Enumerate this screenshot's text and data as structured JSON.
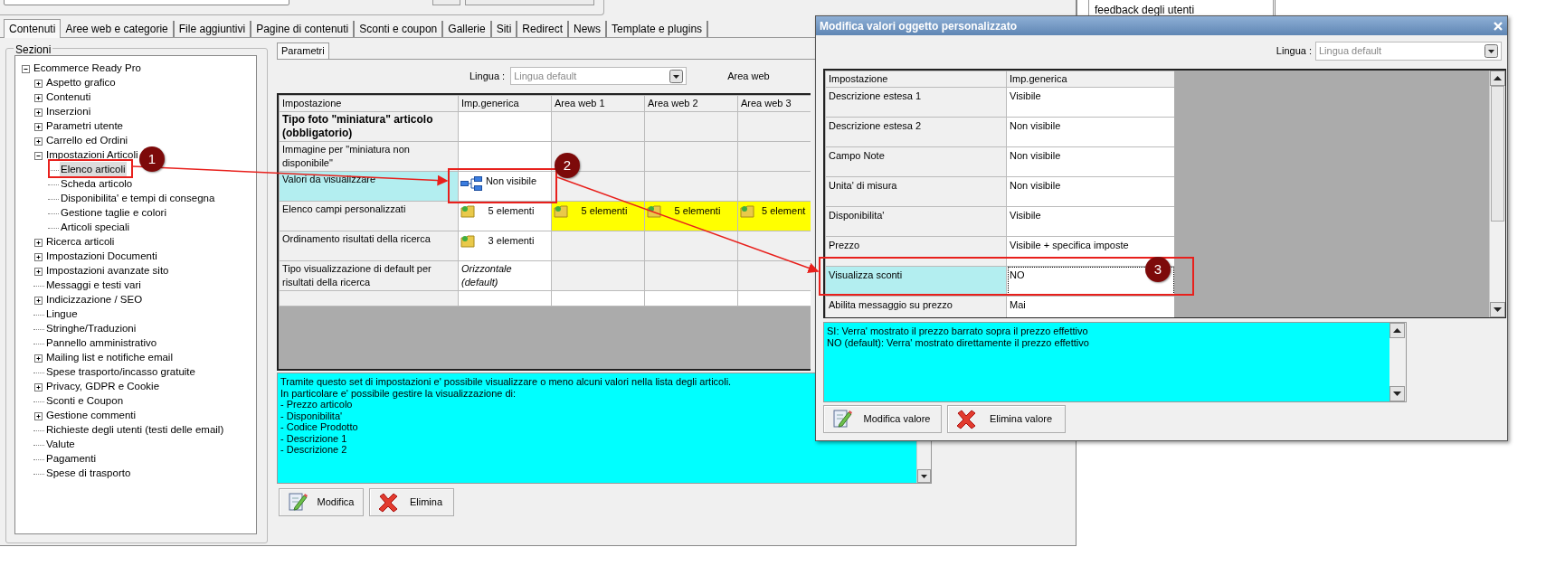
{
  "background_panel": {
    "text": "feedback degli utenti"
  },
  "tabs": [
    {
      "label": "Contenuti",
      "selected": true
    },
    {
      "label": "Aree web e categorie",
      "selected": false
    },
    {
      "label": "File aggiuntivi",
      "selected": false
    },
    {
      "label": "Pagine di contenuti",
      "selected": false
    },
    {
      "label": "Sconti e coupon",
      "selected": false
    },
    {
      "label": "Gallerie",
      "selected": false
    },
    {
      "label": "Siti",
      "selected": false
    },
    {
      "label": "Redirect",
      "selected": false
    },
    {
      "label": "News",
      "selected": false
    },
    {
      "label": "Template e plugins",
      "selected": false
    }
  ],
  "sections": {
    "title": "Sezioni",
    "tree": [
      {
        "label": "Ecommerce Ready Pro",
        "selected": false,
        "expanded": true,
        "children": [
          {
            "label": "Aspetto grafico",
            "selected": false,
            "expanded": false
          },
          {
            "label": "Contenuti",
            "selected": false,
            "expanded": false
          },
          {
            "label": "Inserzioni",
            "selected": false,
            "expanded": false
          },
          {
            "label": "Parametri utente",
            "selected": false,
            "expanded": false
          },
          {
            "label": "Carrello ed Ordini",
            "selected": false,
            "expanded": false
          },
          {
            "label": "Impostazioni Articoli",
            "selected": false,
            "expanded": true,
            "children": [
              {
                "label": "Elenco articoli",
                "selected": true
              },
              {
                "label": "Scheda articolo",
                "selected": false
              },
              {
                "label": "Disponibilita' e tempi di consegna",
                "selected": false
              },
              {
                "label": "Gestione taglie e colori",
                "selected": false
              },
              {
                "label": "Articoli speciali",
                "selected": false
              }
            ]
          },
          {
            "label": "Ricerca articoli",
            "selected": false,
            "expanded": false
          },
          {
            "label": "Impostazioni Documenti",
            "selected": false,
            "expanded": false
          },
          {
            "label": "Impostazioni avanzate sito",
            "selected": false,
            "expanded": false
          },
          {
            "label": "Messaggi e testi vari",
            "selected": false
          },
          {
            "label": "Indicizzazione / SEO",
            "selected": false,
            "expanded": false
          },
          {
            "label": "Lingue",
            "selected": false
          },
          {
            "label": "Stringhe/Traduzioni",
            "selected": false
          },
          {
            "label": "Pannello amministrativo",
            "selected": false
          },
          {
            "label": "Mailing list e notifiche email",
            "selected": false,
            "expanded": false
          },
          {
            "label": "Spese trasporto/incasso gratuite",
            "selected": false
          },
          {
            "label": "Privacy, GDPR e Cookie",
            "selected": false,
            "expanded": false
          },
          {
            "label": "Sconti e Coupon",
            "selected": false
          },
          {
            "label": "Gestione commenti",
            "selected": false,
            "expanded": false
          },
          {
            "label": "Richieste degli utenti (testi delle email)",
            "selected": false
          },
          {
            "label": "Valute",
            "selected": false
          },
          {
            "label": "Pagamenti",
            "selected": false
          },
          {
            "label": "Spese di trasporto",
            "selected": false
          }
        ]
      }
    ]
  },
  "subtabs": [
    {
      "label": "Parametri",
      "selected": true
    }
  ],
  "language": {
    "label": "Lingua :",
    "value": "Lingua default"
  },
  "area_label": "Area web",
  "grid": {
    "columns": [
      "Impostazione",
      "Imp.generica",
      "Area web 1",
      "Area web 2",
      "Area web 3"
    ],
    "rows": [
      {
        "selected": false,
        "cells": [
          {
            "kind": "setting",
            "text": "Tipo foto \"miniatura\" articolo (obbligatorio)",
            "bold": true
          },
          {
            "kind": "empty"
          },
          {
            "kind": "empty"
          },
          {
            "kind": "empty"
          },
          {
            "kind": "empty"
          }
        ]
      },
      {
        "selected": false,
        "cells": [
          {
            "kind": "setting",
            "text": "Immagine per \"miniatura non disponibile\"",
            "bold": false
          },
          {
            "kind": "empty"
          },
          {
            "kind": "empty"
          },
          {
            "kind": "empty"
          },
          {
            "kind": "empty"
          }
        ]
      },
      {
        "selected": true,
        "cells": [
          {
            "kind": "setting",
            "text": "Valori da visualizzare",
            "bold": false
          },
          {
            "kind": "tree",
            "text": "Non visibile"
          },
          {
            "kind": "empty"
          },
          {
            "kind": "empty"
          },
          {
            "kind": "empty"
          }
        ]
      },
      {
        "selected": false,
        "cells": [
          {
            "kind": "setting",
            "text": "Elenco campi personalizzati",
            "bold": false
          },
          {
            "kind": "folder",
            "text": "5 elementi",
            "highlighted": false
          },
          {
            "kind": "folder",
            "text": "5 elementi",
            "highlighted": true
          },
          {
            "kind": "folder",
            "text": "5 elementi",
            "highlighted": true
          },
          {
            "kind": "folder",
            "text": "5 element",
            "highlighted": true
          }
        ]
      },
      {
        "selected": false,
        "cells": [
          {
            "kind": "setting",
            "text": "Ordinamento risultati della ricerca",
            "bold": false
          },
          {
            "kind": "folder",
            "text": "3 elementi",
            "highlighted": false
          },
          {
            "kind": "empty"
          },
          {
            "kind": "empty"
          },
          {
            "kind": "empty"
          }
        ]
      },
      {
        "selected": false,
        "cells": [
          {
            "kind": "setting",
            "text": "Tipo visualizzazione di default per risultati della ricerca",
            "bold": false
          },
          {
            "kind": "italic",
            "text": "Orizzontale (default)"
          },
          {
            "kind": "empty"
          },
          {
            "kind": "empty"
          },
          {
            "kind": "empty"
          }
        ]
      },
      {
        "selected": false,
        "cells": [
          {
            "kind": "empty"
          },
          {
            "kind": "blank"
          },
          {
            "kind": "blank"
          },
          {
            "kind": "blank"
          },
          {
            "kind": "blank"
          }
        ]
      }
    ]
  },
  "description": "Tramite questo set di impostazioni e' possibile visualizzare o meno alcuni valori nella lista degli articoli.\nIn particolare e' possibile gestire la visualizzazione di:\n- Prezzo articolo\n- Disponibilita'\n- Codice Prodotto\n- Descrizione 1\n- Descrizione 2",
  "buttons": [
    {
      "label": "Modifica",
      "kind": "edit"
    },
    {
      "label": "Elimina",
      "kind": "delete"
    }
  ],
  "dialog": {
    "title": "Modifica valori oggetto personalizzato",
    "language": {
      "label": "Lingua :",
      "value": "Lingua default"
    },
    "columns": [
      "Impostazione",
      "Imp.generica"
    ],
    "rows": [
      {
        "setting": "Descrizione estesa 1",
        "value": "Visibile",
        "selected": false
      },
      {
        "setting": "Descrizione estesa 2",
        "value": "Non visibile",
        "selected": false
      },
      {
        "setting": "Campo Note",
        "value": "Non visibile",
        "selected": false
      },
      {
        "setting": "Unita' di misura",
        "value": "Non visibile",
        "selected": false
      },
      {
        "setting": "Disponibilita'",
        "value": "Visibile",
        "selected": false
      },
      {
        "setting": "Prezzo",
        "value": "Visibile + specifica imposte",
        "selected": false
      },
      {
        "setting": "Visualizza sconti",
        "value": "NO",
        "selected": true
      },
      {
        "setting": "Abilita messaggio su prezzo",
        "value": "Mai",
        "selected": false
      }
    ],
    "description": "SI: Verra' mostrato il prezzo barrato sopra il prezzo effettivo\nNO (default): Verra' mostrato direttamente il prezzo effettivo",
    "buttons": [
      {
        "label": "Modifica valore",
        "kind": "edit"
      },
      {
        "label": "Elimina valore",
        "kind": "delete"
      }
    ]
  },
  "annotations": [
    {
      "number": "1"
    },
    {
      "number": "2"
    },
    {
      "number": "3"
    }
  ]
}
